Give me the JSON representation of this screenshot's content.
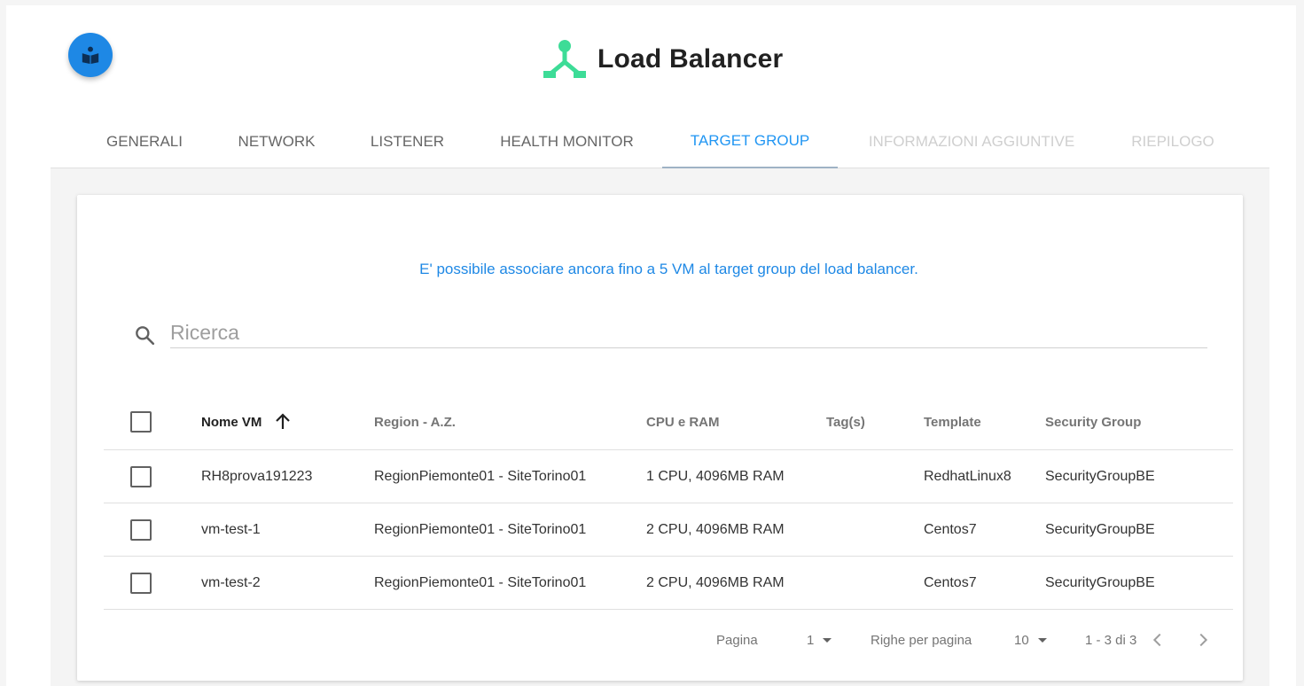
{
  "header": {
    "title": "Load Balancer",
    "help_icon": "book-reader-icon",
    "brand_icon": "load-balancer-icon",
    "brand_color": "#3ddc97"
  },
  "tabs": [
    {
      "label": "GENERALI",
      "state": "normal"
    },
    {
      "label": "NETWORK",
      "state": "normal"
    },
    {
      "label": "LISTENER",
      "state": "normal"
    },
    {
      "label": "HEALTH MONITOR",
      "state": "normal"
    },
    {
      "label": "TARGET GROUP",
      "state": "active"
    },
    {
      "label": "INFORMAZIONI AGGIUNTIVE",
      "state": "disabled"
    },
    {
      "label": "RIEPILOGO",
      "state": "disabled"
    }
  ],
  "info_message": "E' possibile associare ancora fino a 5 VM al target group del load balancer.",
  "search": {
    "placeholder": "Ricerca",
    "value": ""
  },
  "table": {
    "columns": [
      "Nome VM",
      "Region - A.Z.",
      "CPU e RAM",
      "Tag(s)",
      "Template",
      "Security Group"
    ],
    "sort_column": "Nome VM",
    "sort_direction": "asc",
    "rows": [
      {
        "name": "RH8prova191223",
        "region": "RegionPiemonte01 - SiteTorino01",
        "cpu_ram": "1 CPU, 4096MB RAM",
        "tags": "",
        "template": "RedhatLinux8",
        "security_group": "SecurityGroupBE",
        "checked": false
      },
      {
        "name": "vm-test-1",
        "region": "RegionPiemonte01 - SiteTorino01",
        "cpu_ram": "2 CPU, 4096MB RAM",
        "tags": "",
        "template": "Centos7",
        "security_group": "SecurityGroupBE",
        "checked": false
      },
      {
        "name": "vm-test-2",
        "region": "RegionPiemonte01 - SiteTorino01",
        "cpu_ram": "2 CPU, 4096MB RAM",
        "tags": "",
        "template": "Centos7",
        "security_group": "SecurityGroupBE",
        "checked": false
      }
    ]
  },
  "pagination": {
    "page_label": "Pagina",
    "page_value": "1",
    "rows_label": "Righe per pagina",
    "rows_value": "10",
    "range": "1 - 3 di 3"
  },
  "colors": {
    "accent": "#2196f3",
    "info_text": "#1e88e5",
    "fab": "#1e88e5"
  }
}
